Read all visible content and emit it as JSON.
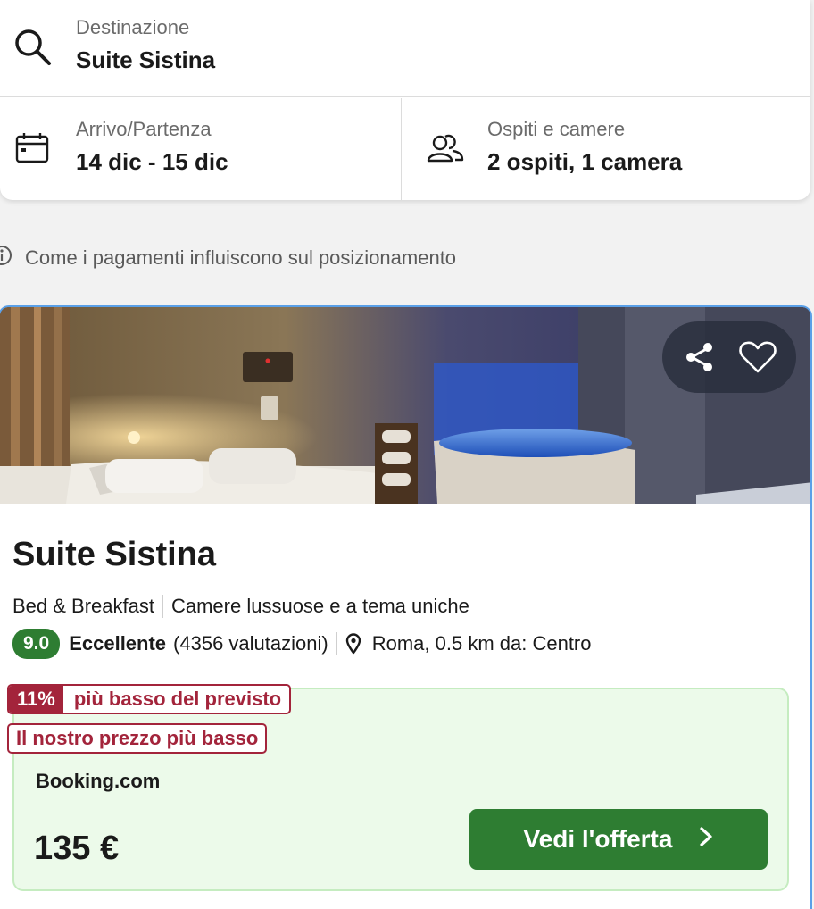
{
  "search": {
    "destination_label": "Destinazione",
    "destination_value": "Suite Sistina",
    "dates_label": "Arrivo/Partenza",
    "dates_value": "14 dic - 15 dic",
    "guests_label": "Ospiti e camere",
    "guests_value": "2 ospiti, 1 camera"
  },
  "payment_info": "Come i pagamenti influiscono sul posizionamento",
  "hotel": {
    "name": "Suite Sistina",
    "type": "Bed & Breakfast",
    "tagline": "Camere lussuose e a tema uniche",
    "score": "9.0",
    "rating_word": "Eccellente",
    "reviews": "(4356 valutazioni)",
    "location": "Roma, 0.5 km da: Centro",
    "icons": {
      "share": "share-icon",
      "favorite": "heart-icon",
      "location": "map-pin-icon"
    }
  },
  "offer": {
    "discount_pct": "11%",
    "discount_text": "più basso del previsto",
    "lowest_label": "Il nostro prezzo più basso",
    "provider": "Booking.com",
    "price": "135 €",
    "cta_label": "Vedi l'offerta"
  },
  "colors": {
    "accent_green": "#2e7d32",
    "badge_red": "#a3243b",
    "offer_bg": "#ecfaea",
    "card_border": "#5aa0e8"
  }
}
